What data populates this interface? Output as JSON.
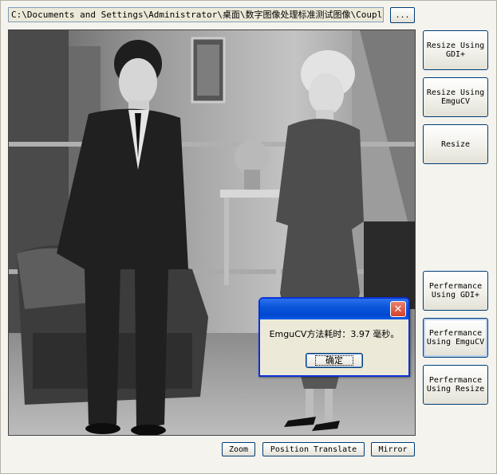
{
  "file_path": "C:\\Documents and Settings\\Administrator\\桌面\\数字图像处理标准测试图像\\Couple.b",
  "browse_label": "...",
  "right_buttons": {
    "resize_gdi": "Resize Using\nGDI+",
    "resize_emgu": "Resize Using\nEmguCV",
    "resize": "Resize",
    "perf_gdi": "Perfermance\nUsing GDI+",
    "perf_emgu": "Perfermance\nUsing EmguCV",
    "perf_resize": "Perfermance\nUsing Resize"
  },
  "bottom_buttons": {
    "zoom": "Zoom",
    "position_translate": "Position Translate",
    "mirror": "Mirror"
  },
  "dialog": {
    "message": "EmguCV方法耗时：3.97 毫秒。",
    "ok_label": "确定",
    "close_glyph": "✕"
  },
  "colors": {
    "title_bar": "#0a56d9",
    "window_bg": "#ece9d8",
    "close_button": "#d4412b"
  }
}
